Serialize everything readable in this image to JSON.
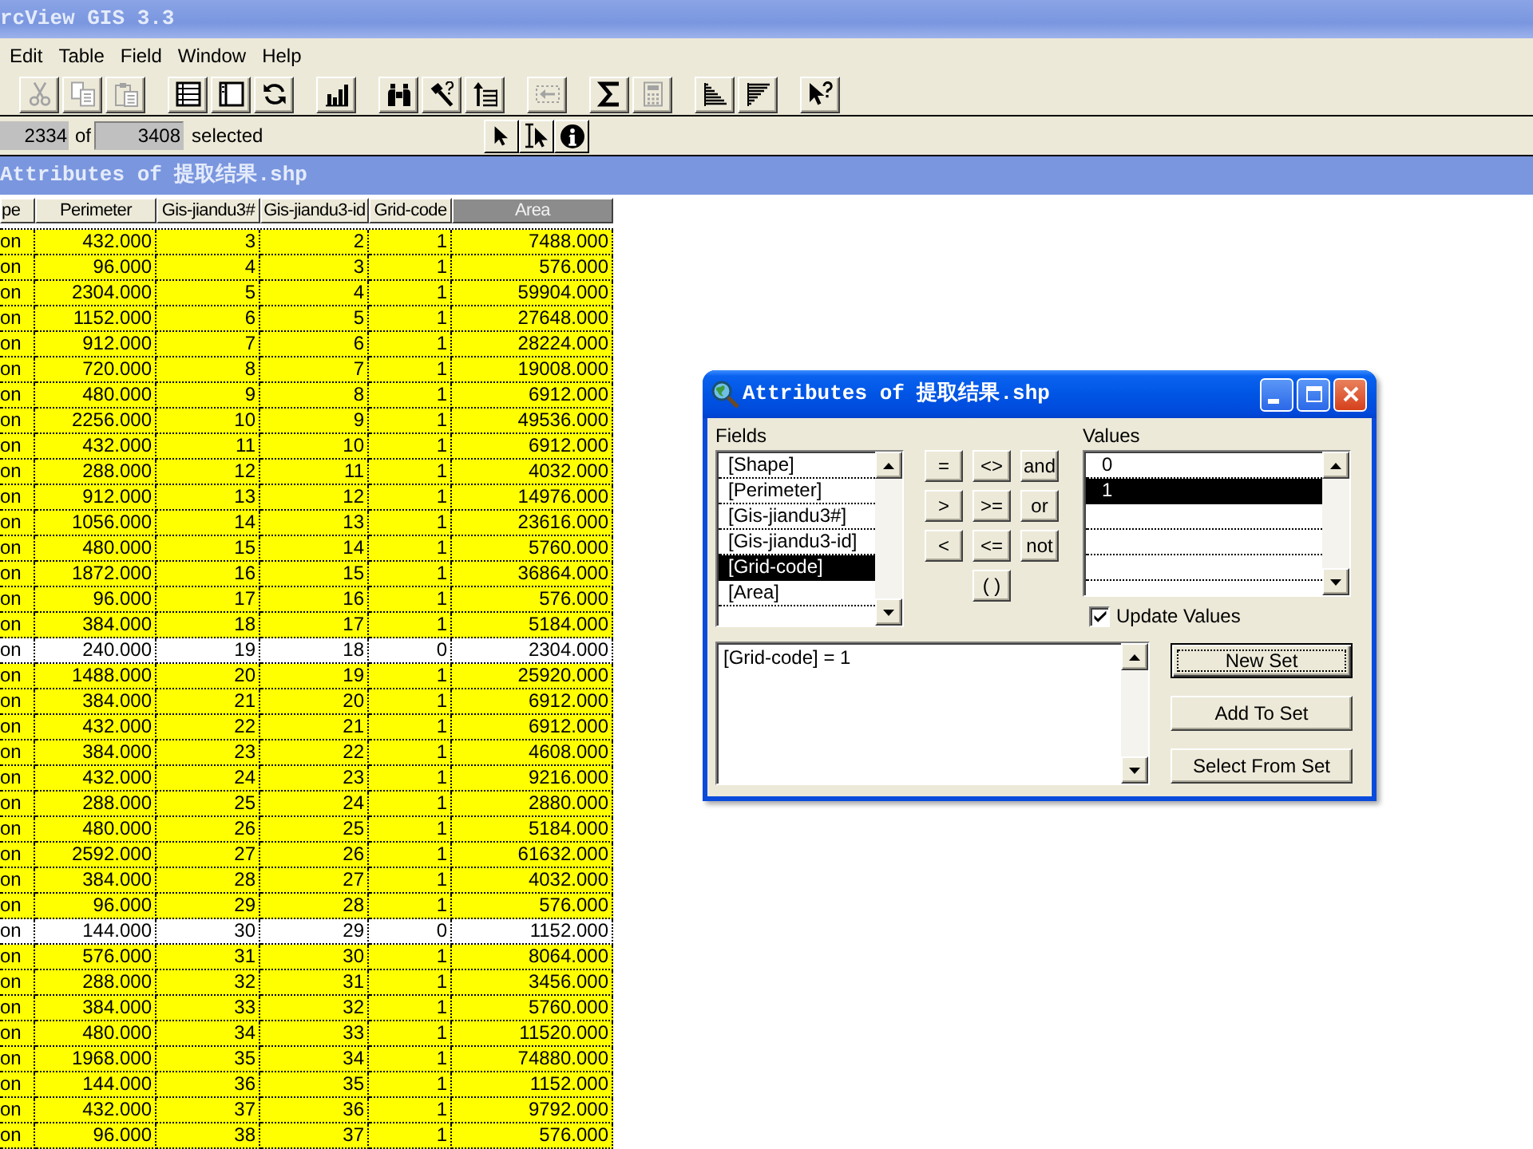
{
  "app_window": {
    "title": "rcView GIS 3.3"
  },
  "menu_bar": [
    "Edit",
    "Table",
    "Field",
    "Window",
    "Help"
  ],
  "toolbar": {
    "groups": [
      [
        {
          "disabled": true
        },
        {
          "disabled": true
        },
        {
          "disabled": true
        }
      ],
      [
        {
          "disabled": false
        },
        {
          "disabled": false
        },
        {
          "disabled": false
        }
      ],
      [
        {
          "disabled": false
        }
      ],
      [
        {
          "disabled": false
        },
        {
          "disabled": false
        },
        {
          "disabled": false
        }
      ],
      [
        {
          "disabled": true
        }
      ],
      [
        {
          "disabled": false
        },
        {
          "disabled": true
        }
      ],
      [
        {
          "disabled": false
        },
        {
          "disabled": false
        }
      ],
      [
        {
          "disabled": false
        }
      ]
    ]
  },
  "selection_bar": {
    "selected_count": "2334",
    "of_label": "of",
    "total_count": "3408",
    "selected_label": "selected"
  },
  "table_window": {
    "title": "Attributes of 提取结果.shp",
    "columns": [
      {
        "label": "pe",
        "selected": false
      },
      {
        "label": "Perimeter",
        "selected": false
      },
      {
        "label": "Gis-jiandu3#",
        "selected": false
      },
      {
        "label": "Gis-jiandu3-id",
        "selected": false
      },
      {
        "label": "Grid-code",
        "selected": false
      },
      {
        "label": "Area",
        "selected": true
      }
    ],
    "rows": [
      {
        "selected": true,
        "cells": [
          "on",
          "432.000",
          "3",
          "2",
          "1",
          "7488.000"
        ]
      },
      {
        "selected": true,
        "cells": [
          "on",
          "96.000",
          "4",
          "3",
          "1",
          "576.000"
        ]
      },
      {
        "selected": true,
        "cells": [
          "on",
          "2304.000",
          "5",
          "4",
          "1",
          "59904.000"
        ]
      },
      {
        "selected": true,
        "cells": [
          "on",
          "1152.000",
          "6",
          "5",
          "1",
          "27648.000"
        ]
      },
      {
        "selected": true,
        "cells": [
          "on",
          "912.000",
          "7",
          "6",
          "1",
          "28224.000"
        ]
      },
      {
        "selected": true,
        "cells": [
          "on",
          "720.000",
          "8",
          "7",
          "1",
          "19008.000"
        ]
      },
      {
        "selected": true,
        "cells": [
          "on",
          "480.000",
          "9",
          "8",
          "1",
          "6912.000"
        ]
      },
      {
        "selected": true,
        "cells": [
          "on",
          "2256.000",
          "10",
          "9",
          "1",
          "49536.000"
        ]
      },
      {
        "selected": true,
        "cells": [
          "on",
          "432.000",
          "11",
          "10",
          "1",
          "6912.000"
        ]
      },
      {
        "selected": true,
        "cells": [
          "on",
          "288.000",
          "12",
          "11",
          "1",
          "4032.000"
        ]
      },
      {
        "selected": true,
        "cells": [
          "on",
          "912.000",
          "13",
          "12",
          "1",
          "14976.000"
        ]
      },
      {
        "selected": true,
        "cells": [
          "on",
          "1056.000",
          "14",
          "13",
          "1",
          "23616.000"
        ]
      },
      {
        "selected": true,
        "cells": [
          "on",
          "480.000",
          "15",
          "14",
          "1",
          "5760.000"
        ]
      },
      {
        "selected": true,
        "cells": [
          "on",
          "1872.000",
          "16",
          "15",
          "1",
          "36864.000"
        ]
      },
      {
        "selected": true,
        "cells": [
          "on",
          "96.000",
          "17",
          "16",
          "1",
          "576.000"
        ]
      },
      {
        "selected": true,
        "cells": [
          "on",
          "384.000",
          "18",
          "17",
          "1",
          "5184.000"
        ]
      },
      {
        "selected": false,
        "cells": [
          "on",
          "240.000",
          "19",
          "18",
          "0",
          "2304.000"
        ]
      },
      {
        "selected": true,
        "cells": [
          "on",
          "1488.000",
          "20",
          "19",
          "1",
          "25920.000"
        ]
      },
      {
        "selected": true,
        "cells": [
          "on",
          "384.000",
          "21",
          "20",
          "1",
          "6912.000"
        ]
      },
      {
        "selected": true,
        "cells": [
          "on",
          "432.000",
          "22",
          "21",
          "1",
          "6912.000"
        ]
      },
      {
        "selected": true,
        "cells": [
          "on",
          "384.000",
          "23",
          "22",
          "1",
          "4608.000"
        ]
      },
      {
        "selected": true,
        "cells": [
          "on",
          "432.000",
          "24",
          "23",
          "1",
          "9216.000"
        ]
      },
      {
        "selected": true,
        "cells": [
          "on",
          "288.000",
          "25",
          "24",
          "1",
          "2880.000"
        ]
      },
      {
        "selected": true,
        "cells": [
          "on",
          "480.000",
          "26",
          "25",
          "1",
          "5184.000"
        ]
      },
      {
        "selected": true,
        "cells": [
          "on",
          "2592.000",
          "27",
          "26",
          "1",
          "61632.000"
        ]
      },
      {
        "selected": true,
        "cells": [
          "on",
          "384.000",
          "28",
          "27",
          "1",
          "4032.000"
        ]
      },
      {
        "selected": true,
        "cells": [
          "on",
          "96.000",
          "29",
          "28",
          "1",
          "576.000"
        ]
      },
      {
        "selected": false,
        "cells": [
          "on",
          "144.000",
          "30",
          "29",
          "0",
          "1152.000"
        ]
      },
      {
        "selected": true,
        "cells": [
          "on",
          "576.000",
          "31",
          "30",
          "1",
          "8064.000"
        ]
      },
      {
        "selected": true,
        "cells": [
          "on",
          "288.000",
          "32",
          "31",
          "1",
          "3456.000"
        ]
      },
      {
        "selected": true,
        "cells": [
          "on",
          "384.000",
          "33",
          "32",
          "1",
          "5760.000"
        ]
      },
      {
        "selected": true,
        "cells": [
          "on",
          "480.000",
          "34",
          "33",
          "1",
          "11520.000"
        ]
      },
      {
        "selected": true,
        "cells": [
          "on",
          "1968.000",
          "35",
          "34",
          "1",
          "74880.000"
        ]
      },
      {
        "selected": true,
        "cells": [
          "on",
          "144.000",
          "36",
          "35",
          "1",
          "1152.000"
        ]
      },
      {
        "selected": true,
        "cells": [
          "on",
          "432.000",
          "37",
          "36",
          "1",
          "9792.000"
        ]
      },
      {
        "selected": true,
        "cells": [
          "on",
          "96.000",
          "38",
          "37",
          "1",
          "576.000"
        ]
      }
    ]
  },
  "query_dialog": {
    "title": "Attributes of 提取结果.shp",
    "fields_label": "Fields",
    "fields": [
      {
        "label": "[Shape]",
        "selected": false
      },
      {
        "label": "[Perimeter]",
        "selected": false
      },
      {
        "label": "[Gis-jiandu3#]",
        "selected": false
      },
      {
        "label": "[Gis-jiandu3-id]",
        "selected": false
      },
      {
        "label": "[Grid-code]",
        "selected": true
      },
      {
        "label": "[Area]",
        "selected": false
      }
    ],
    "operators": [
      [
        "=",
        "<>",
        "and"
      ],
      [
        ">",
        ">=",
        "or"
      ],
      [
        "<",
        "<=",
        "not"
      ],
      [
        "( )"
      ]
    ],
    "values_label": "Values",
    "values": [
      {
        "label": "0",
        "selected": false
      },
      {
        "label": "1",
        "selected": true
      }
    ],
    "update_values": {
      "label": "Update Values",
      "checked": true
    },
    "expression": "[Grid-code] = 1",
    "buttons": [
      {
        "label": "New Set",
        "default": true
      },
      {
        "label": "Add To Set",
        "default": false
      },
      {
        "label": "Select From Set",
        "default": false
      }
    ]
  }
}
